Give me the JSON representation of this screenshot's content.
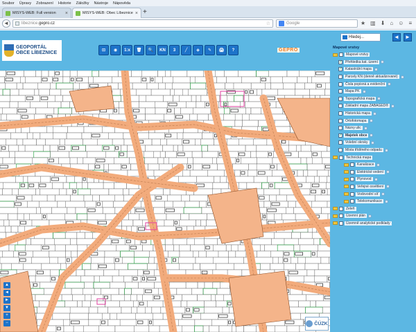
{
  "menu": [
    "Soubor",
    "Úpravy",
    "Zobrazení",
    "Historie",
    "Záložky",
    "Nástroje",
    "Nápověda"
  ],
  "tabs": [
    {
      "title": "MISYS-WEB: Full version",
      "active": false
    },
    {
      "title": "MISYS-WEB: Obec Líbeznice",
      "active": true
    }
  ],
  "url": {
    "prefix": "libeznice.",
    "domain": "gepro.cz"
  },
  "search_placeholder": "Google",
  "app": {
    "logo_line1": "GEOPORTÁL",
    "logo_line2": "OBCE LÍBEZNICE",
    "toolbar": [
      "⊡",
      "◉",
      "1:x",
      "🗑",
      "🔍",
      "KN",
      "3",
      "╱",
      "◈",
      "✎",
      "🖨",
      "?"
    ],
    "brand": "GEPRO",
    "search_label": "Hledej..."
  },
  "panel": {
    "title": "Mapové vrstvy",
    "layers": [
      {
        "label": "Mapové vrstvy",
        "indent": 0,
        "folder": true,
        "checked": false,
        "bold": false,
        "info": false
      },
      {
        "label": "Přehledka kat. území",
        "indent": 1,
        "folder": false,
        "checked": true,
        "bold": false,
        "info": true
      },
      {
        "label": "Katastrální mapa",
        "indent": 1,
        "folder": false,
        "checked": true,
        "bold": false,
        "info": true
      },
      {
        "label": "Parcely KN (denně aktualizované)",
        "indent": 1,
        "folder": false,
        "checked": false,
        "bold": false,
        "info": true
      },
      {
        "label": "Čísla popisná a evidenční",
        "indent": 1,
        "folder": false,
        "checked": false,
        "bold": false,
        "info": true
      },
      {
        "label": "Mapa PK",
        "indent": 1,
        "folder": false,
        "checked": false,
        "bold": false,
        "info": true
      },
      {
        "label": "Topografická mapa",
        "indent": 1,
        "folder": false,
        "checked": false,
        "bold": false,
        "info": true
      },
      {
        "label": "Základní mapa ZABAGED®",
        "indent": 1,
        "folder": false,
        "checked": false,
        "bold": false,
        "info": true
      },
      {
        "label": "Historická mapa",
        "indent": 1,
        "folder": false,
        "checked": false,
        "bold": false,
        "info": true
      },
      {
        "label": "Ortofotomapa",
        "indent": 1,
        "folder": false,
        "checked": false,
        "bold": false,
        "info": true
      },
      {
        "label": "Názvy ulic",
        "indent": 1,
        "folder": false,
        "checked": false,
        "bold": false,
        "info": true
      },
      {
        "label": "Majetek obce",
        "indent": 1,
        "folder": false,
        "checked": true,
        "bold": true,
        "info": true
      },
      {
        "label": "Volební okrsky",
        "indent": 1,
        "folder": false,
        "checked": false,
        "bold": false,
        "info": true
      },
      {
        "label": "Místa tříděného odpadu",
        "indent": 1,
        "folder": false,
        "checked": false,
        "bold": false,
        "info": true
      },
      {
        "label": "Technická mapa",
        "indent": 0,
        "folder": true,
        "checked": false,
        "bold": false,
        "info": false
      },
      {
        "label": "Kanalizace",
        "indent": 2,
        "folder": true,
        "checked": false,
        "bold": false,
        "info": true
      },
      {
        "label": "Elektrické vedení",
        "indent": 2,
        "folder": true,
        "checked": false,
        "bold": false,
        "info": true
      },
      {
        "label": "Plynovod",
        "indent": 2,
        "folder": true,
        "checked": false,
        "bold": false,
        "info": true
      },
      {
        "label": "Veřejné osvětlení",
        "indent": 2,
        "folder": true,
        "checked": false,
        "bold": false,
        "info": true
      },
      {
        "label": "Vodovodní síť",
        "indent": 2,
        "folder": true,
        "checked": false,
        "bold": false,
        "info": true
      },
      {
        "label": "Telekomunikace",
        "indent": 2,
        "folder": true,
        "checked": false,
        "bold": false,
        "info": true
      },
      {
        "label": "Zeleň",
        "indent": 0,
        "folder": true,
        "checked": false,
        "bold": false,
        "info": false
      },
      {
        "label": "Územní plán",
        "indent": 0,
        "folder": true,
        "checked": false,
        "bold": false,
        "info": true
      },
      {
        "label": "Územně analytické podklady",
        "indent": 0,
        "folder": true,
        "checked": false,
        "bold": false,
        "info": false
      }
    ]
  },
  "map_nav": [
    "▲",
    "◄",
    "►",
    "▼",
    "+",
    "−"
  ],
  "cuzk": "ČÚZK"
}
